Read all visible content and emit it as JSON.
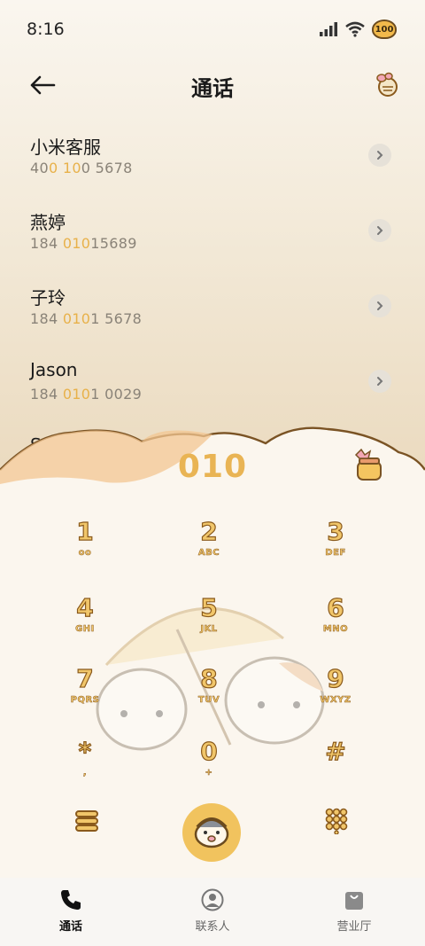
{
  "status_bar": {
    "time": "8:16",
    "battery_label": "100"
  },
  "header": {
    "title": "通话"
  },
  "contacts": [
    {
      "name": "小米客服",
      "number_parts": [
        "40",
        "0 10",
        "0 5678"
      ]
    },
    {
      "name": "燕婷",
      "number_parts": [
        "184 ",
        "010",
        "15689"
      ]
    },
    {
      "name": "子玲",
      "number_parts": [
        "184 ",
        "010",
        "1 5678"
      ]
    },
    {
      "name": "Jason",
      "number_parts": [
        "184 ",
        "010",
        "1 0029"
      ]
    }
  ],
  "partial_contact": "Ste",
  "dialpad": {
    "entered": "010",
    "keys": [
      {
        "digit": "1",
        "letters": "oo"
      },
      {
        "digit": "2",
        "letters": "ABC"
      },
      {
        "digit": "3",
        "letters": "DEF"
      },
      {
        "digit": "4",
        "letters": "GHI"
      },
      {
        "digit": "5",
        "letters": "JKL"
      },
      {
        "digit": "6",
        "letters": "MNO"
      },
      {
        "digit": "7",
        "letters": "PQRS"
      },
      {
        "digit": "8",
        "letters": "TUV"
      },
      {
        "digit": "9",
        "letters": "WXYZ"
      },
      {
        "digit": "*",
        "letters": ","
      },
      {
        "digit": "0",
        "letters": "+"
      },
      {
        "digit": "#",
        "letters": ""
      }
    ]
  },
  "nav": {
    "tabs": [
      {
        "label": "通话",
        "icon": "phone-icon",
        "active": true
      },
      {
        "label": "联系人",
        "icon": "person-icon",
        "active": false
      },
      {
        "label": "营业厅",
        "icon": "shopping-bag-icon",
        "active": false
      }
    ]
  },
  "colors": {
    "accent": "#e9b454",
    "key_outline": "#8a5a1c",
    "background": "#f7f1e6"
  }
}
